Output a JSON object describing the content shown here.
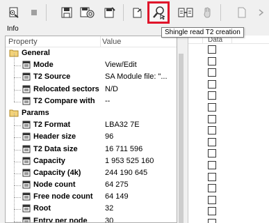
{
  "toolbar": {
    "buttons": [
      {
        "name": "open-disk-icon"
      },
      {
        "name": "stop-icon"
      },
      {
        "name": "save-icon"
      },
      {
        "name": "save-settings-icon"
      },
      {
        "name": "export-icon"
      },
      {
        "name": "open-file-icon"
      },
      {
        "name": "search-read-icon"
      },
      {
        "name": "compare-icon"
      },
      {
        "name": "hand-icon"
      },
      {
        "name": "document-icon"
      },
      {
        "name": "chevron-icon"
      }
    ],
    "highlight_color": "#e0142a"
  },
  "info": {
    "label": "Info"
  },
  "tooltip": {
    "text": "Shingle read T2 creation"
  },
  "table": {
    "header_property": "Property",
    "header_value": "Value",
    "rows": [
      {
        "kind": "cat",
        "label": "General",
        "value": ""
      },
      {
        "kind": "prop",
        "label": "Mode",
        "value": "View/Edit"
      },
      {
        "kind": "prop",
        "label": "T2 Source",
        "value": "SA Module file: \"..."
      },
      {
        "kind": "prop",
        "label": "Relocated sectors",
        "value": "N/D"
      },
      {
        "kind": "prop",
        "label": "T2 Compare with",
        "value": "--"
      },
      {
        "kind": "cat",
        "label": "Params",
        "value": ""
      },
      {
        "kind": "prop",
        "label": "T2 Format",
        "value": "LBA32 7E"
      },
      {
        "kind": "prop",
        "label": "Header size",
        "value": "96"
      },
      {
        "kind": "prop",
        "label": "T2 Data size",
        "value": "16 711 596"
      },
      {
        "kind": "prop",
        "label": "Capacity",
        "value": "1 953 525 160"
      },
      {
        "kind": "prop",
        "label": "Capacity (4k)",
        "value": "244 190 645"
      },
      {
        "kind": "prop",
        "label": "Node count",
        "value": "64 275"
      },
      {
        "kind": "prop",
        "label": "Free node count",
        "value": "64 149"
      },
      {
        "kind": "prop",
        "label": "Root",
        "value": "32"
      },
      {
        "kind": "prop",
        "label": "Entry per node",
        "value": "30"
      }
    ]
  },
  "right_panel": {
    "header_data": "Data",
    "checkbox_count": 16
  }
}
